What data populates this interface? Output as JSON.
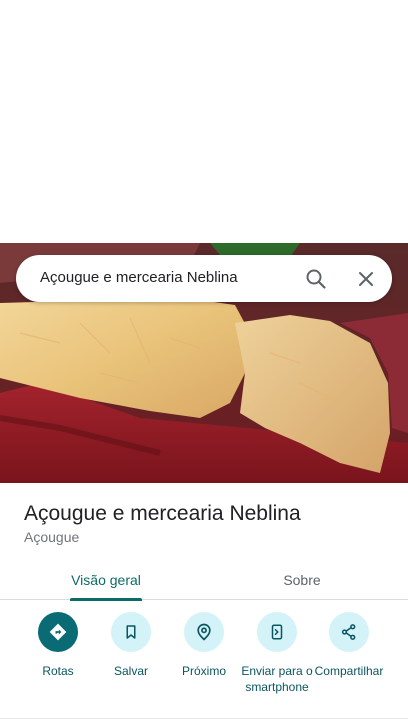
{
  "search": {
    "query": "Açougue e mercearia Neblina",
    "search_icon": "search-icon",
    "clear_icon": "close-icon"
  },
  "place": {
    "name": "Açougue e mercearia Neblina",
    "category": "Açougue",
    "photo_subject": "raw meat cuts"
  },
  "tabs": [
    {
      "label": "Visão geral",
      "active": true
    },
    {
      "label": "Sobre",
      "active": false
    }
  ],
  "actions": [
    {
      "label": "Rotas",
      "icon": "directions-icon"
    },
    {
      "label": "Salvar",
      "icon": "bookmark-icon"
    },
    {
      "label": "Próximo",
      "icon": "nearby-icon"
    },
    {
      "label": "Enviar para o smartphone",
      "icon": "send-to-phone-icon"
    },
    {
      "label": "Compartilhar",
      "icon": "share-icon"
    }
  ],
  "colors": {
    "accent": "#0b6b6b",
    "action_bg": "#d3f3f8",
    "primary_action_bg": "#0b6b75",
    "text_primary": "#202124",
    "text_secondary": "#70757a"
  }
}
